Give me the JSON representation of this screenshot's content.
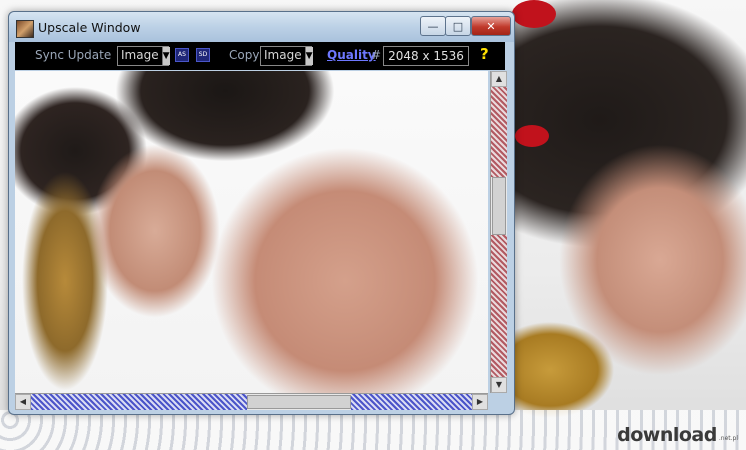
{
  "window": {
    "title": "Upscale Window"
  },
  "toolbar": {
    "sync_update": "Sync Update",
    "image_combo_1": "Image",
    "copy_label": "Copy",
    "image_combo_2": "Image",
    "quality_label": "Quality",
    "hash_label": "#",
    "resolution": "2048 x 1536",
    "help": "?"
  },
  "watermark": {
    "brand": "download",
    "suffix": ".net.pl"
  },
  "colors": {
    "accent_link": "#6e78ff",
    "toolbar_bg": "#000000",
    "close_button": "#c0392b"
  }
}
